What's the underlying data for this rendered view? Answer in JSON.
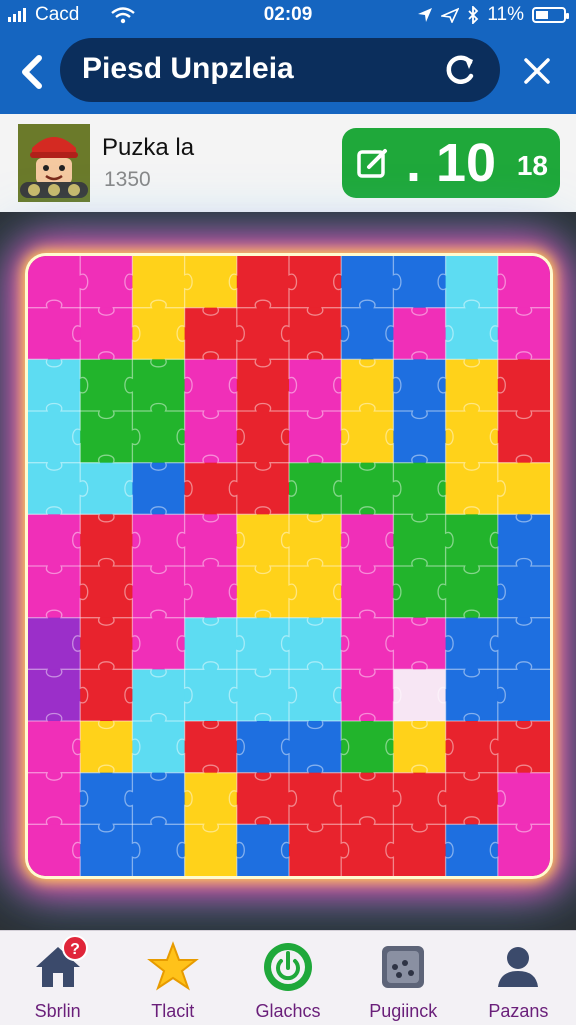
{
  "status": {
    "carrier": "Cacd",
    "time": "02:09",
    "battery": "11%"
  },
  "header": {
    "title": "Piesd Unpzleia",
    "back_icon": "chevron-left-icon",
    "refresh_icon": "refresh-icon",
    "close_icon": "close-icon"
  },
  "player": {
    "name": "Puzka la",
    "score": "1350"
  },
  "score_button": {
    "main": ". 10",
    "suffix": "18",
    "icon": "edit-icon"
  },
  "colors": {
    "accent": "#1565c0",
    "green": "#1fa83a",
    "tab_text": "#6a1f7a"
  },
  "tabs": [
    {
      "label": "Sbrlin",
      "icon": "home-icon",
      "badge": "?"
    },
    {
      "label": "Tlacit",
      "icon": "star-icon"
    },
    {
      "label": "Glachcs",
      "icon": "power-icon"
    },
    {
      "label": "Pugiinck",
      "icon": "dice-icon"
    },
    {
      "label": "Pazans",
      "icon": "person-icon"
    }
  ],
  "puzzle": {
    "cols": 10,
    "rows": 12,
    "palette": {
      "M": "#f02fb8",
      "Y": "#ffd21a",
      "R": "#e8232d",
      "B": "#1e6fe0",
      "G": "#22b42c",
      "C": "#5ddcf2",
      "P": "#9b2fc9",
      "W": "#f7e6f4"
    },
    "grid": [
      "MMYYRRBBCM",
      "MMYRRRBMCM",
      "CGGMRMYBYR",
      "CGGMRMYBYR",
      "CCBRRGGGYY",
      "MRMMYYMGGB",
      "MRMMYYMGGB",
      "PRMCCCMMBB",
      "PRCCCCMWBB",
      "MYCRBBGYRR",
      "MBBYRRRRRM",
      "MBBYBRRRBM"
    ]
  }
}
